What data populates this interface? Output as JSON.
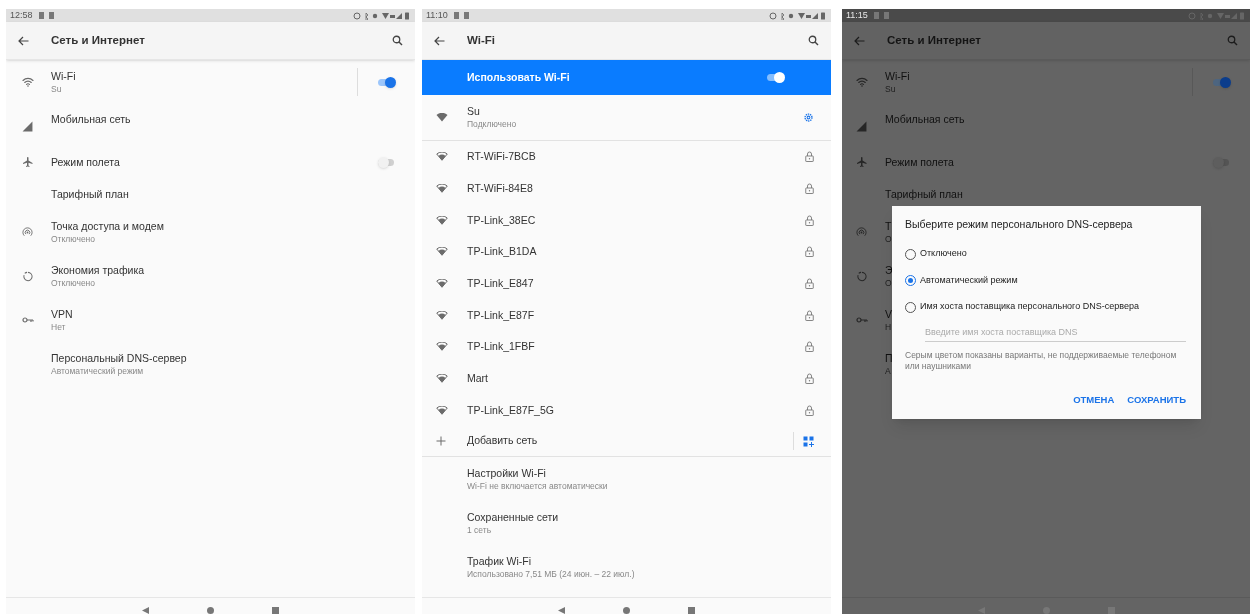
{
  "screens": [
    {
      "status_bar": {
        "time": "12:58"
      },
      "toolbar": {
        "title": "Сеть и Интернет"
      },
      "items": [
        {
          "kind": "wifi",
          "title": "Wi-Fi",
          "subtitle": "Su",
          "switch_on": true
        },
        {
          "kind": "mobile",
          "title": "Мобильная сеть"
        },
        {
          "kind": "airplane",
          "title": "Режим полета",
          "switch_on": false
        },
        {
          "kind": "plan",
          "title": "Тарифный план"
        },
        {
          "kind": "hotspot",
          "title": "Точка доступа и модем",
          "subtitle": "Отключено"
        },
        {
          "kind": "datasaver",
          "title": "Экономия трафика",
          "subtitle": "Отключено"
        },
        {
          "kind": "vpn",
          "title": "VPN",
          "subtitle": "Нет"
        },
        {
          "kind": "dns",
          "title": "Персональный DNS-сервер",
          "subtitle": "Автоматический режим"
        }
      ]
    },
    {
      "status_bar": {
        "time": "11:10"
      },
      "toolbar": {
        "title": "Wi-Fi"
      },
      "master_switch": {
        "label": "Использовать Wi-Fi",
        "on": true
      },
      "networks": [
        {
          "kind": "connected",
          "name": "Su",
          "status": "Подключено"
        },
        {
          "kind": "secured",
          "name": "RT-WiFi-7BCB"
        },
        {
          "kind": "secured",
          "name": "RT-WiFi-84E8"
        },
        {
          "kind": "secured",
          "name": "TP-Link_38EC"
        },
        {
          "kind": "secured",
          "name": "TP-Link_B1DA"
        },
        {
          "kind": "secured",
          "name": "TP-Link_E847"
        },
        {
          "kind": "secured",
          "name": "TP-Link_E87F"
        },
        {
          "kind": "secured",
          "name": "TP-Link_1FBF"
        },
        {
          "kind": "secured",
          "name": "Mart"
        },
        {
          "kind": "secured",
          "name": "TP-Link_E87F_5G"
        }
      ],
      "add_network": {
        "label": "Добавить сеть"
      },
      "items": [
        {
          "kind": "pref",
          "title": "Настройки Wi-Fi",
          "subtitle": "Wi-Fi не включается автоматически"
        },
        {
          "kind": "pref",
          "title": "Сохраненные сети",
          "subtitle": "1 сеть"
        },
        {
          "kind": "pref",
          "title": "Трафик Wi-Fi",
          "subtitle": "Использовано 7,51 МБ (24 июн. – 22 июл.)"
        }
      ]
    },
    {
      "status_bar": {
        "time": "11:15"
      },
      "toolbar": {
        "title": "Сеть и Интернет"
      },
      "items": [
        {
          "kind": "wifi",
          "title": "Wi-Fi",
          "subtitle": "Su",
          "switch_on": true
        },
        {
          "kind": "mobile",
          "title": "Мобильная сеть"
        },
        {
          "kind": "airplane",
          "title": "Режим полета",
          "switch_on": false
        },
        {
          "kind": "plan",
          "title": "Тарифный план"
        },
        {
          "kind": "hotspot",
          "title": "Т",
          "subtitle": "О"
        },
        {
          "kind": "datasaver",
          "title": "Э",
          "subtitle": "О"
        },
        {
          "kind": "vpn",
          "title": "V",
          "subtitle": "Н"
        },
        {
          "kind": "dns",
          "title": "П",
          "subtitle": "А"
        }
      ],
      "dialog": {
        "title": "Выберите режим персонального DNS-сервера",
        "options": [
          {
            "label": "Отключено",
            "selected": false
          },
          {
            "label": "Автоматический режим",
            "selected": true
          },
          {
            "label": "Имя хоста поставщика персонального DNS-сервера",
            "selected": false
          }
        ],
        "field": {
          "placeholder": "Введите имя хоста поставщика DNS"
        },
        "note": "Серым цветом показаны варианты, не поддерживаемые телефоном или наушниками",
        "buttons": [
          "ОТМЕНА",
          "СОХРАНИТЬ"
        ]
      }
    }
  ]
}
